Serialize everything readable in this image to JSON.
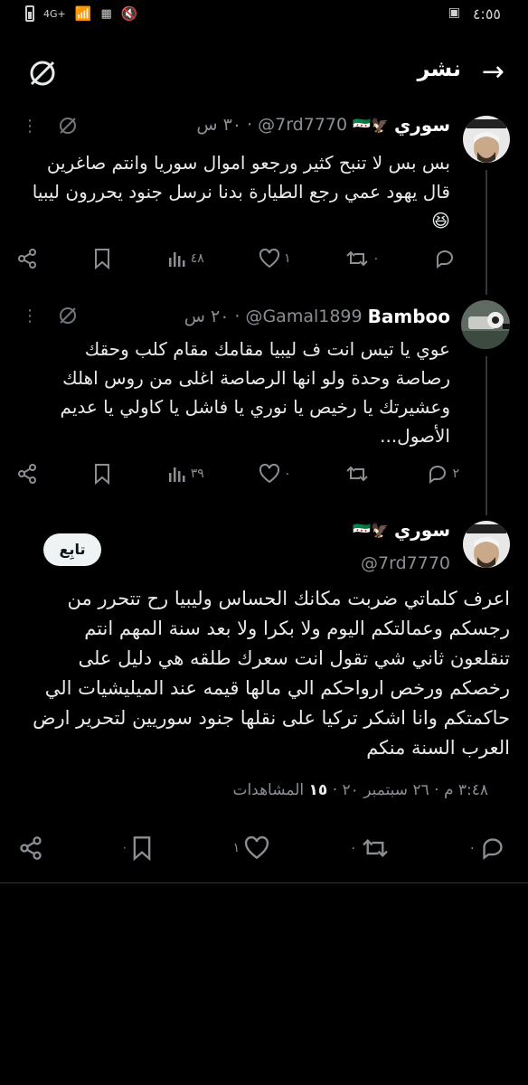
{
  "status_bar": {
    "time": "٤:٥٥",
    "network": "4G+"
  },
  "header": {
    "title": "نشر",
    "back_icon": "arrow-right-icon",
    "grok_icon": "slash-circle-icon"
  },
  "posts": [
    {
      "name": "سوري",
      "flags": "🇸🇾🦅",
      "handle": "@7rd7770",
      "time": "٣٠ س",
      "text": "بس بس لا تنبح كثير ورجعو اموال سوريا وانتم صاغرين قال يهود عمي رجع الطيارة بدنا نرسل جنود يحررون ليبيا 😆",
      "stats": {
        "replies": "",
        "reposts": "٠",
        "likes": "١",
        "views": "٤٨"
      }
    },
    {
      "name": "Bamboo",
      "handle": "@Gamal1899",
      "time": "٢٠ س",
      "text": "عوي يا تيس انت ف ليبيا مقامك مقام كلب وحقك رصاصة وحدة ولو انها الرصاصة اغلى من روس اهلك وعشيرتك يا رخيص يا نوري يا فاشل يا كاولي يا عديم الأصول...",
      "stats": {
        "replies": "٢",
        "reposts": "",
        "likes": "٠",
        "views": "٣٩"
      }
    },
    {
      "name": "سوري",
      "flags": "🇸🇾🦅",
      "handle": "@7rd7770",
      "follow_label": "تابِع",
      "text": "اعرف كلماتي ضربت مكانك الحساس وليبيا رح تتحرر من رجسكم وعمالتكم اليوم ولا بكرا ولا بعد سنة المهم انتم تنقلعون ثاني شي تقول انت سعرك طلقه هي دليل على رخصكم ورخص ارواحكم الي مالها قيمه عند الميليشيات الي حاكمتكم وانا اشكر تركيا على نقلها جنود سوريين لتحرير ارض العرب السنة منكم",
      "meta_time": "٣:٤٨ م",
      "meta_date": "٢٦ سبتمبر ٢٠",
      "views_count": "١٥",
      "views_label": "المشاهدات",
      "stats": {
        "replies": "٠",
        "reposts": "٠",
        "likes": "١"
      }
    }
  ]
}
